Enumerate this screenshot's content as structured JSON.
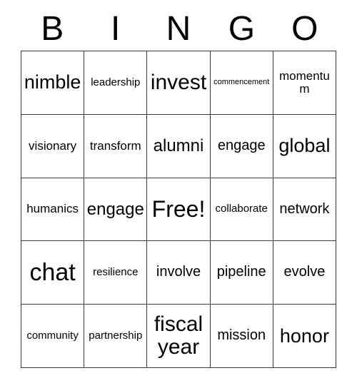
{
  "header": {
    "letters": [
      "B",
      "I",
      "N",
      "G",
      "O"
    ]
  },
  "grid": {
    "rows": 5,
    "columns": 5,
    "free_space": {
      "row": 2,
      "column": 2,
      "label": "Free!"
    },
    "cells": [
      [
        {
          "text": "nimble",
          "size": "xl"
        },
        {
          "text": "leadership",
          "size": "s"
        },
        {
          "text": "invest",
          "size": "xxl"
        },
        {
          "text": "commencement",
          "size": "xs"
        },
        {
          "text": "momentum",
          "size": "m"
        }
      ],
      [
        {
          "text": "visionary",
          "size": "m"
        },
        {
          "text": "transform",
          "size": "m"
        },
        {
          "text": "alumni",
          "size": "l"
        },
        {
          "text": "engage",
          "size": "ml"
        },
        {
          "text": "global",
          "size": "xl"
        }
      ],
      [
        {
          "text": "humanics",
          "size": "m"
        },
        {
          "text": "engage",
          "size": "l"
        },
        {
          "text": "Free!",
          "size": "free"
        },
        {
          "text": "collaborate",
          "size": "s"
        },
        {
          "text": "network",
          "size": "ml"
        }
      ],
      [
        {
          "text": "chat",
          "size": "huge"
        },
        {
          "text": "resilience",
          "size": "s"
        },
        {
          "text": "involve",
          "size": "ml"
        },
        {
          "text": "pipeline",
          "size": "ml"
        },
        {
          "text": "evolve",
          "size": "ml"
        }
      ],
      [
        {
          "text": "community",
          "size": "s"
        },
        {
          "text": "partnership",
          "size": "s"
        },
        {
          "text": "fiscal year",
          "size": "xxl"
        },
        {
          "text": "mission",
          "size": "ml"
        },
        {
          "text": "honor",
          "size": "xl"
        }
      ]
    ]
  },
  "colors": {
    "background": "#ffffff",
    "border": "#3a3a3a",
    "text": "#000000"
  }
}
